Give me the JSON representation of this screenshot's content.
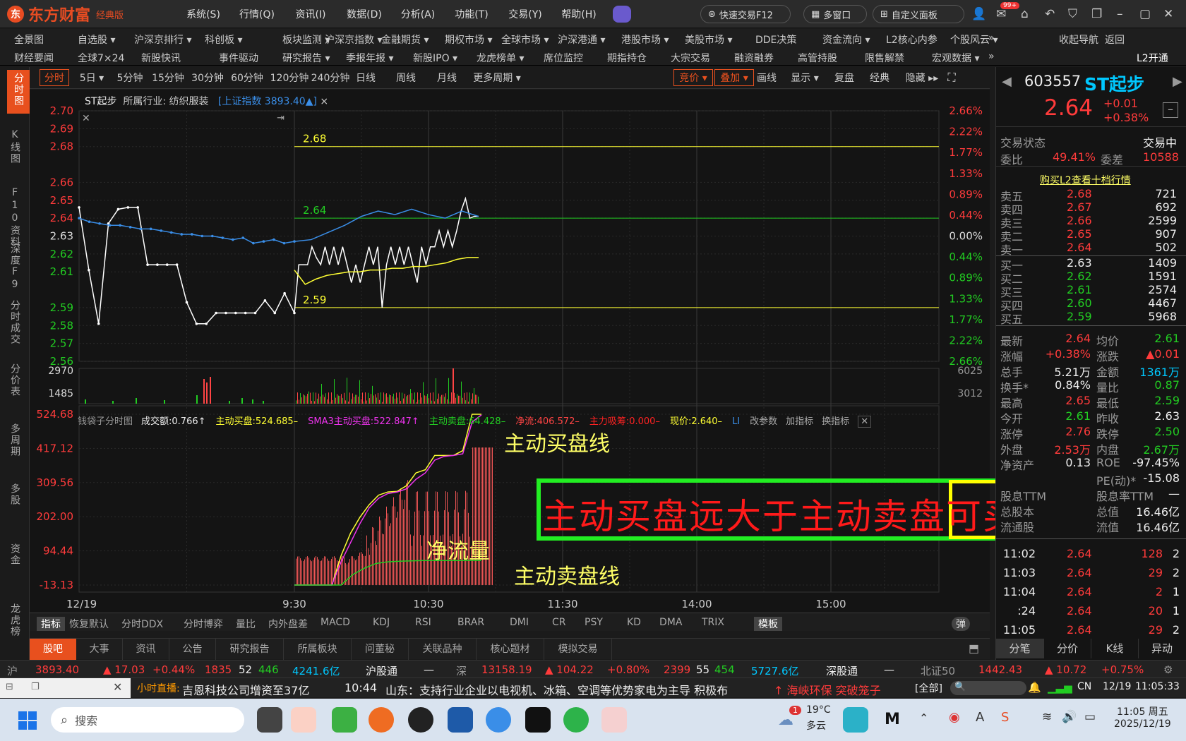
{
  "app": {
    "name": "东方财富",
    "edition": "经典版"
  },
  "main_menu": [
    "系统(S)",
    "行情(Q)",
    "资讯(I)",
    "数据(D)",
    "分析(A)",
    "功能(T)",
    "交易(Y)",
    "帮助(H)"
  ],
  "toolbar": {
    "quick_trade": "快速交易F12",
    "multi_window": "多窗口",
    "custom_panel": "自定义面板",
    "badge": "99+"
  },
  "nav_row1": [
    "全景图",
    "自选股 ▾",
    "沪深京排行 ▾",
    "科创板 ▾",
    "板块监测 ▾",
    "沪深京指数 ▾",
    "金融期货 ▾",
    "期权市场 ▾",
    "全球市场 ▾",
    "沪深港通 ▾",
    "港股市场 ▾",
    "美股市场 ▾",
    "DDE决策",
    "资金流向 ▾",
    "L2核心内参",
    "个股风云 ▾",
    "»",
    "收起导航",
    "返回"
  ],
  "nav_row2": [
    "财经要闻",
    "全球7×24",
    "新股快讯",
    "事件驱动",
    "研究报告 ▾",
    "季报年报 ▾",
    "新股IPO ▾",
    "龙虎榜单 ▾",
    "席位监控",
    "期指持仓",
    "大宗交易",
    "融资融券",
    "高管持股",
    "限售解禁",
    "宏观数据 ▾",
    "»",
    "L2开通"
  ],
  "left_tabs": [
    {
      "label": "分时图",
      "active": true
    },
    {
      "label": "K线图",
      "active": false
    },
    {
      "label": "F10资料",
      "active": false
    },
    {
      "label": "深度F9",
      "active": false
    },
    {
      "label": "分时成交",
      "active": false
    },
    {
      "label": "分价表",
      "active": false
    },
    {
      "label": "多周期",
      "active": false
    },
    {
      "label": "多股",
      "active": false
    },
    {
      "label": "资金",
      "active": false
    },
    {
      "label": "龙虎榜",
      "active": false
    }
  ],
  "periods": [
    "分时",
    "5日 ▾",
    "5分钟",
    "15分钟",
    "30分钟",
    "60分钟",
    "120分钟",
    "240分钟",
    "日线",
    "周线",
    "月线",
    "更多周期 ▾"
  ],
  "chart_tools": [
    "竞价 ▾",
    "叠加 ▾",
    "画线",
    "显示 ▾",
    "复盘",
    "经典",
    "隐藏 ▸▸"
  ],
  "info_line": {
    "stock": "ST起步",
    "industry_label": "所属行业:",
    "industry": "纺织服装",
    "index_overlay": "[上证指数 3893.40▲]",
    "close_mark": "×"
  },
  "indicator_line": {
    "name": "钱袋子分时图",
    "items": [
      {
        "text": "成交额:0.766↑",
        "color": "#eeeeee"
      },
      {
        "text": "主动买盘:524.685–",
        "color": "#ffff33"
      },
      {
        "text": "SMA3主动买盘:522.847↑",
        "color": "#ee33ee"
      },
      {
        "text": "主动卖盘:64.428–",
        "color": "#22cc22"
      },
      {
        "text": "净流:406.572–",
        "color": "#ff4444"
      },
      {
        "text": "主力吸筹:0.000–",
        "color": "#ff2222"
      },
      {
        "text": "现价:2.640–",
        "color": "#ffff33"
      },
      {
        "text": "LI",
        "color": "#3a8ee8"
      }
    ],
    "actions": [
      "改参数",
      "加指标",
      "换指标"
    ]
  },
  "chart_data": {
    "type": "line",
    "title": "",
    "x_time_labels": [
      "9:30",
      "10:30",
      "11:30",
      "14:00",
      "15:00"
    ],
    "date_label": "12/19",
    "price_axis": {
      "ticks": [
        2.7,
        2.69,
        2.68,
        2.66,
        2.65,
        2.64,
        2.63,
        2.62,
        2.61,
        2.59,
        2.58,
        2.57,
        2.56
      ],
      "ylim": [
        2.56,
        2.7
      ]
    },
    "pct_axis": {
      "ticks": [
        "2.66%",
        "2.22%",
        "1.77%",
        "1.33%",
        "0.89%",
        "0.44%",
        "0.00%",
        "0.44%",
        "0.89%",
        "1.33%",
        "1.77%",
        "2.22%",
        "2.66%"
      ]
    },
    "volume_axis": {
      "left": [
        "2970",
        "1485"
      ],
      "right": [
        "6025",
        "3012"
      ]
    },
    "indicator_axis": {
      "ticks": [
        "524.68",
        "417.12",
        "309.56",
        "202.00",
        "94.44",
        "-13.13"
      ],
      "ylim": [
        -13.13,
        524.68
      ]
    },
    "horizontal_lines": [
      {
        "value": 2.68,
        "label": "2.68",
        "color": "#ffff33"
      },
      {
        "value": 2.64,
        "label": "2.64",
        "color": "#22cc22"
      },
      {
        "value": 2.59,
        "label": "2.59",
        "color": "#ffff33"
      }
    ],
    "series": [
      {
        "name": "",
        "color": "#ffffff",
        "values": [
          2.646,
          2.611,
          2.581,
          2.637,
          2.645,
          2.646,
          2.646,
          2.614,
          2.614,
          2.614,
          2.614,
          2.593,
          2.581,
          2.581,
          2.587,
          2.587,
          2.587,
          2.587,
          2.587,
          2.594,
          2.587,
          2.598,
          2.587,
          2.614,
          2.614,
          2.614,
          2.624,
          2.618,
          2.614,
          2.624,
          2.614,
          2.624,
          2.614,
          2.624,
          2.614,
          2.604,
          2.614,
          2.604,
          2.614,
          2.624,
          2.614,
          2.624,
          2.59,
          2.614,
          2.624,
          2.614,
          2.624,
          2.614,
          2.624,
          2.614,
          2.604,
          2.624,
          2.614,
          2.624,
          2.624,
          2.633,
          2.624,
          2.633,
          2.624,
          2.633,
          2.644,
          2.651,
          2.64,
          2.641,
          2.641
        ]
      },
      {
        "name": "",
        "color": "#3a8ee8",
        "values": [
          2.64,
          2.638,
          2.637,
          2.636,
          2.636,
          2.635,
          2.634,
          2.634,
          2.633,
          2.632,
          2.631,
          2.631,
          2.63,
          2.63,
          2.629,
          2.628,
          2.629,
          2.626,
          2.627,
          2.628,
          2.626,
          2.627,
          2.628,
          2.632,
          2.636,
          2.641,
          2.644,
          2.642,
          2.645,
          2.642,
          2.64,
          2.644,
          2.641
        ]
      },
      {
        "name": "",
        "color": "#ffff33",
        "values": [
          2.611,
          2.603,
          2.606,
          2.608,
          2.609,
          2.61,
          2.61,
          2.611,
          2.611,
          2.612,
          2.612,
          2.613,
          2.613,
          2.614,
          2.615,
          2.617,
          2.618,
          2.618
        ]
      }
    ],
    "indicator_series": [
      {
        "name": "主动买盘",
        "color": "#ffff33",
        "values": [
          -13,
          -13,
          -13,
          -13,
          -13,
          80,
          150,
          200,
          240,
          270,
          280,
          282,
          300,
          340,
          350,
          395,
          395,
          395,
          410,
          524.7,
          524.7
        ]
      },
      {
        "name": "SMA3主动买盘",
        "color": "#ee33ee",
        "values": [
          -13,
          -13,
          -13,
          -13,
          -13,
          60,
          120,
          180,
          230,
          260,
          275,
          280,
          290,
          320,
          340,
          380,
          392,
          395,
          400,
          500,
          522.8
        ]
      },
      {
        "name": "主动卖盘",
        "color": "#22cc22",
        "values": [
          -13,
          -13,
          -13,
          -13,
          -13,
          20,
          40,
          55,
          60,
          62,
          63,
          64,
          64,
          64,
          64,
          64.4,
          64.4
        ]
      }
    ]
  },
  "annotations": {
    "main": "主动买盘远大于主动卖盘可买进",
    "buy_line": "主动买盘线",
    "sell_line": "主动卖盘线",
    "net_flow": "净流量"
  },
  "indicator_tabs": [
    "指标",
    "恢复默认",
    "分时DDX",
    "分时博弈",
    "量比",
    "内外盘差",
    "MACD",
    "KDJ",
    "RSI",
    "BRAR",
    "DMI",
    "CR",
    "PSY",
    "KD",
    "DMA",
    "TRIX",
    "模板"
  ],
  "toggle_label": "弹",
  "bottom_tabs": [
    "股吧",
    "大事",
    "资讯",
    "公告",
    "研究报告",
    "所属板块",
    "问董秘",
    "关联品种",
    "核心题材",
    "模拟交易"
  ],
  "quote": {
    "code": "603557",
    "name": "ST起步",
    "price": "2.64",
    "change": "+0.01",
    "change_pct": "+0.38%",
    "status_label": "交易状态",
    "status": "交易中",
    "wb_label": "委比",
    "wb": "49.41%",
    "wc_label": "委差",
    "wc": "10588",
    "l2_link": "购买L2查看十档行情",
    "asks": [
      {
        "label": "卖五",
        "price": "2.68",
        "vol": "721"
      },
      {
        "label": "卖四",
        "price": "2.67",
        "vol": "692"
      },
      {
        "label": "卖三",
        "price": "2.66",
        "vol": "2599"
      },
      {
        "label": "卖二",
        "price": "2.65",
        "vol": "907"
      },
      {
        "label": "卖一",
        "price": "2.64",
        "vol": "502"
      }
    ],
    "bids": [
      {
        "label": "买一",
        "price": "2.63",
        "vol": "1409"
      },
      {
        "label": "买二",
        "price": "2.62",
        "vol": "1591"
      },
      {
        "label": "买三",
        "price": "2.61",
        "vol": "2574"
      },
      {
        "label": "买四",
        "price": "2.60",
        "vol": "4467"
      },
      {
        "label": "买五",
        "price": "2.59",
        "vol": "5968"
      }
    ],
    "stats": [
      {
        "l1": "最新",
        "v1": "2.64",
        "c1": "red",
        "l2": "均价",
        "v2": "2.61",
        "c2": "green"
      },
      {
        "l1": "涨幅",
        "v1": "+0.38%",
        "c1": "red",
        "l2": "涨跌",
        "v2": "▲0.01",
        "c2": "red"
      },
      {
        "l1": "总手",
        "v1": "5.21万",
        "c1": "white",
        "l2": "金额",
        "v2": "1361万",
        "c2": "cyan"
      },
      {
        "l1": "换手*",
        "v1": "0.84%",
        "c1": "white",
        "l2": "量比",
        "v2": "0.87",
        "c2": "green"
      },
      {
        "l1": "最高",
        "v1": "2.65",
        "c1": "red",
        "l2": "最低",
        "v2": "2.59",
        "c2": "green"
      },
      {
        "l1": "今开",
        "v1": "2.61",
        "c1": "green",
        "l2": "昨收",
        "v2": "2.63",
        "c2": "white"
      },
      {
        "l1": "涨停",
        "v1": "2.76",
        "c1": "red",
        "l2": "跌停",
        "v2": "2.50",
        "c2": "green"
      },
      {
        "l1": "外盘",
        "v1": "2.53万",
        "c1": "red",
        "l2": "内盘",
        "v2": "2.67万",
        "c2": "green"
      },
      {
        "l1": "净资产",
        "v1": "0.13",
        "c1": "white",
        "l2": "ROE",
        "v2": "-97.45%",
        "c2": "white"
      },
      {
        "l1": "",
        "v1": "",
        "c1": "white",
        "l2": "PE(动)*",
        "v2": "-15.08",
        "c2": "white"
      },
      {
        "l1": "股息TTM",
        "v1": "",
        "c1": "white",
        "l2": "股息率TTM",
        "v2": "—",
        "c2": "white"
      },
      {
        "l1": "总股本",
        "v1": "",
        "c1": "white",
        "l2": "总值",
        "v2": "16.46亿",
        "c2": "white"
      },
      {
        "l1": "流通股",
        "v1": "",
        "c1": "white",
        "l2": "流值",
        "v2": "16.46亿",
        "c2": "white"
      }
    ],
    "ticks": [
      {
        "time": "11:02",
        "price": "2.64",
        "vol": "128",
        "n": "2",
        "vc": "red"
      },
      {
        "time": "11:03",
        "price": "2.64",
        "vol": "29",
        "n": "2",
        "vc": "red"
      },
      {
        "time": "11:04",
        "price": "2.64",
        "vol": "2",
        "n": "1",
        "vc": "red"
      },
      {
        "time": ":24",
        "price": "2.64",
        "vol": "20",
        "n": "1",
        "vc": "red"
      },
      {
        "time": "11:05",
        "price": "2.64",
        "vol": "29",
        "n": "2",
        "vc": "red"
      }
    ],
    "bottom_tabs": [
      "分笔",
      "分价",
      "K线",
      "异动"
    ]
  },
  "statusbar": {
    "sh_label": "沪",
    "sh_index": "3893.40",
    "sh_chg": "▲ 17.03",
    "sh_pct": "+0.44%",
    "sh_up": "1835",
    "sh_flat": "52",
    "sh_down": "446",
    "sh_amt": "4241.6亿",
    "hgt": "沪股通",
    "hgt_val": "—",
    "sz_label": "深",
    "sz_index": "13158.19",
    "sz_chg": "▲ 104.22",
    "sz_pct": "+0.80%",
    "sz_up": "2399",
    "sz_flat": "55",
    "sz_down": "454",
    "sz_amt": "5727.6亿",
    "sgt": "深股通",
    "sgt_val": "—",
    "bz_label": "北证50",
    "bz_index": "1442.43",
    "bz_chg": "▲ 10.72",
    "bz_pct": "+0.75%"
  },
  "newsbar": {
    "live_label": "小时直播:",
    "news1": "吉恩科技公司增资至37亿",
    "time": "10:44",
    "news2": "山东：支持行业企业以电视机、冰箱、空调等优势家电为主导 积极布",
    "hot": "↑ 海峡环保 突破笼子",
    "all": "[全部]",
    "region": "CN",
    "date": "12/19",
    "clock": "11:05:33"
  },
  "taskbar": {
    "search": "搜索",
    "weather_temp": "19°C",
    "weather_desc": "多云",
    "weather_badge": "1",
    "time": "11:05 周五",
    "date": "2025/12/19"
  }
}
